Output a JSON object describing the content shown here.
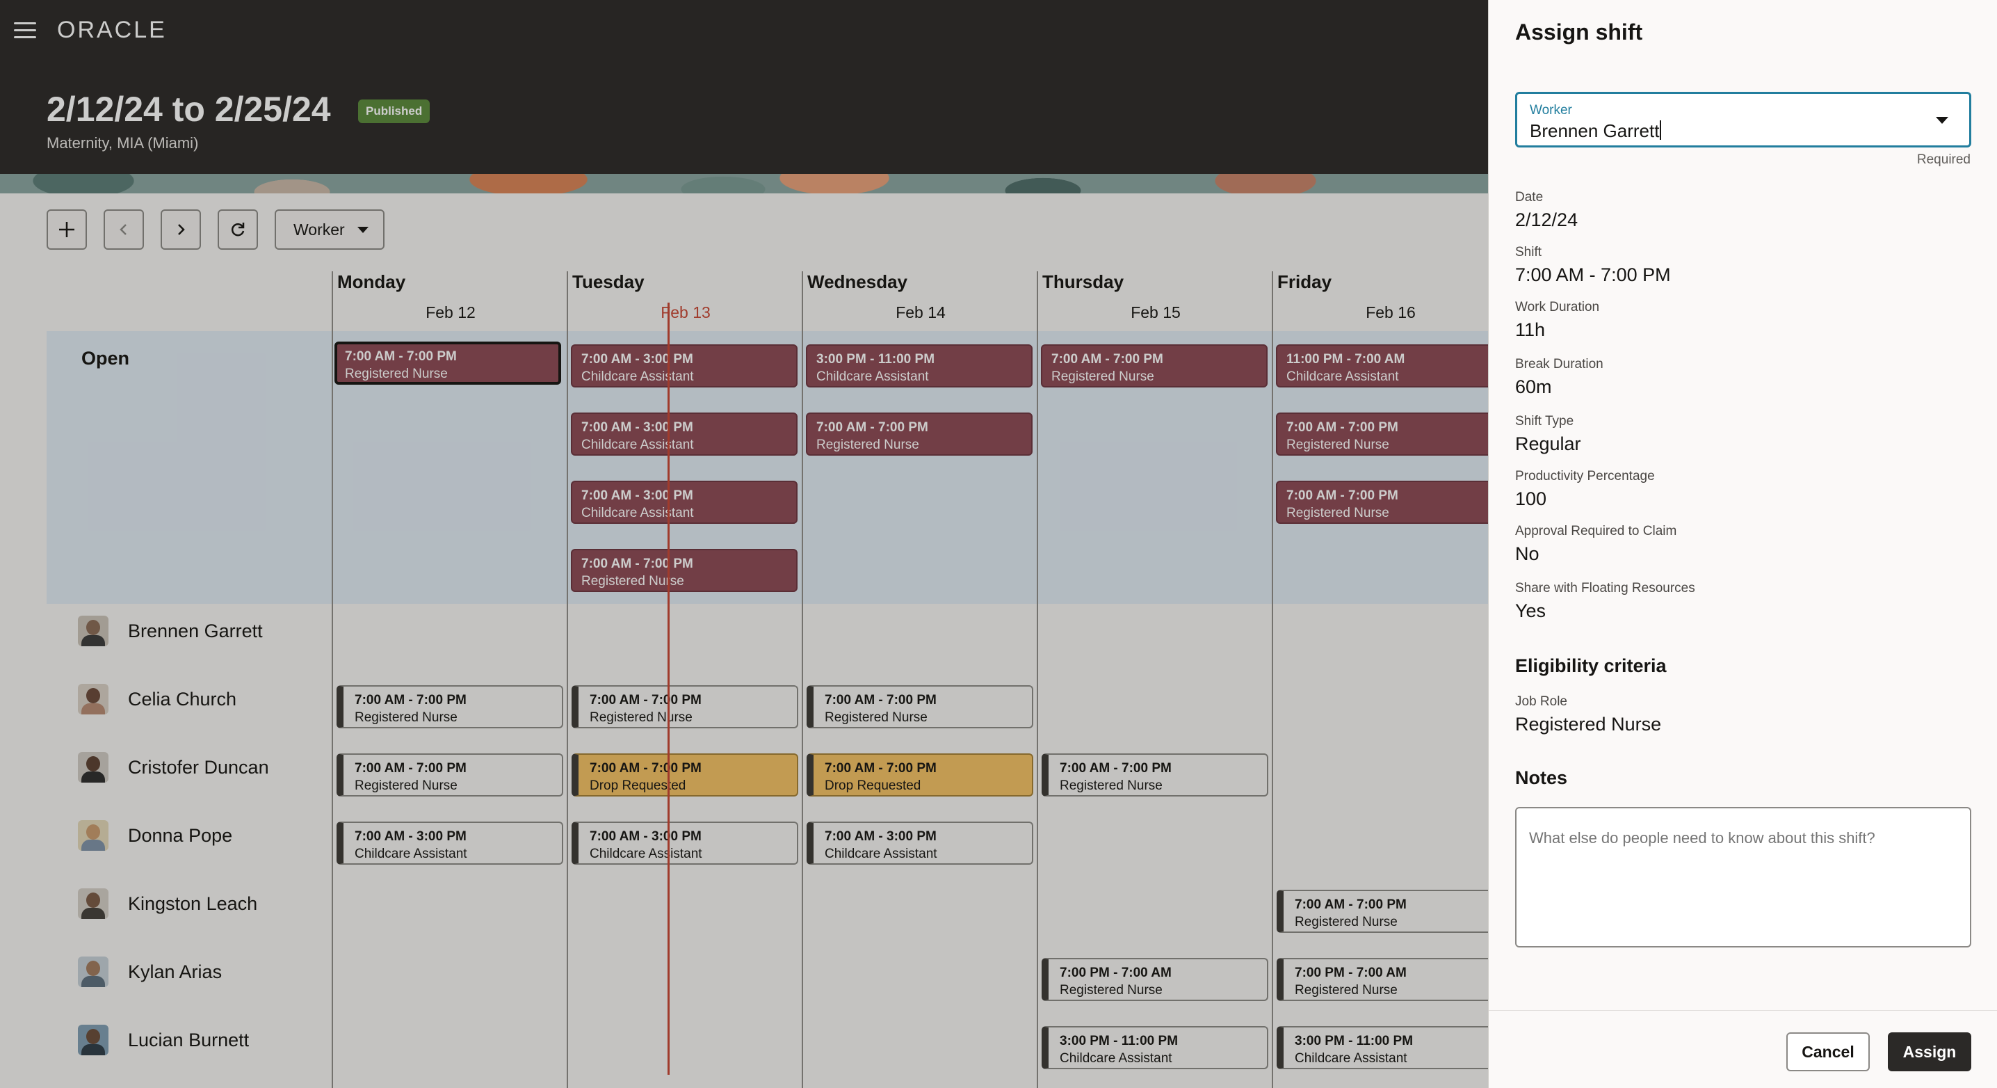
{
  "app": {
    "brand": "ORACLE",
    "schedule_range": "2/12/24 to 2/25/24",
    "status_badge": "Published",
    "location": "Maternity, MIA (Miami)"
  },
  "toolbar": {
    "view_label": "Worker"
  },
  "days": [
    {
      "name": "Monday",
      "date": "Feb 12"
    },
    {
      "name": "Tuesday",
      "date": "Feb 13"
    },
    {
      "name": "Wednesday",
      "date": "Feb 14"
    },
    {
      "name": "Thursday",
      "date": "Feb 15"
    },
    {
      "name": "Friday",
      "date": "Feb 16"
    }
  ],
  "open_label": "Open",
  "workers": [
    {
      "name": "Brennen Garrett"
    },
    {
      "name": "Celia Church"
    },
    {
      "name": "Cristofer Duncan"
    },
    {
      "name": "Donna Pope"
    },
    {
      "name": "Kingston Leach"
    },
    {
      "name": "Kylan Arias"
    },
    {
      "name": "Lucian Burnett"
    }
  ],
  "open_shifts": {
    "mon": [
      {
        "time": "7:00 AM - 7:00 PM",
        "role": "Registered Nurse"
      }
    ],
    "tue": [
      {
        "time": "7:00 AM - 3:00 PM",
        "role": "Childcare Assistant"
      },
      {
        "time": "7:00 AM - 3:00 PM",
        "role": "Childcare Assistant"
      },
      {
        "time": "7:00 AM - 3:00 PM",
        "role": "Childcare Assistant"
      },
      {
        "time": "7:00 AM - 7:00 PM",
        "role": "Registered Nurse"
      }
    ],
    "wed": [
      {
        "time": "3:00 PM - 11:00 PM",
        "role": "Childcare Assistant"
      },
      {
        "time": "7:00 AM - 7:00 PM",
        "role": "Registered Nurse"
      }
    ],
    "thu": [
      {
        "time": "7:00 AM - 7:00 PM",
        "role": "Registered Nurse"
      }
    ],
    "fri": [
      {
        "time": "11:00 PM - 7:00 AM",
        "role": "Childcare Assistant"
      },
      {
        "time": "7:00 AM - 7:00 PM",
        "role": "Registered Nurse"
      },
      {
        "time": "7:00 AM - 7:00 PM",
        "role": "Registered Nurse"
      }
    ]
  },
  "assigned_shifts": {
    "celia_mon": {
      "time": "7:00 AM - 7:00 PM",
      "role": "Registered Nurse"
    },
    "celia_tue": {
      "time": "7:00 AM - 7:00 PM",
      "role": "Registered Nurse"
    },
    "celia_wed": {
      "time": "7:00 AM - 7:00 PM",
      "role": "Registered Nurse"
    },
    "cristofer_mon": {
      "time": "7:00 AM - 7:00 PM",
      "role": "Registered Nurse"
    },
    "cristofer_tue": {
      "time": "7:00 AM - 7:00 PM",
      "role": "Drop Requested"
    },
    "cristofer_wed": {
      "time": "7:00 AM - 7:00 PM",
      "role": "Drop Requested"
    },
    "cristofer_thu": {
      "time": "7:00 AM - 7:00 PM",
      "role": "Registered Nurse"
    },
    "donna_mon": {
      "time": "7:00 AM - 3:00 PM",
      "role": "Childcare Assistant"
    },
    "donna_tue": {
      "time": "7:00 AM - 3:00 PM",
      "role": "Childcare Assistant"
    },
    "donna_wed": {
      "time": "7:00 AM - 3:00 PM",
      "role": "Childcare Assistant"
    },
    "kingston_fri": {
      "time": "7:00 AM - 7:00 PM",
      "role": "Registered Nurse"
    },
    "kylan_thu": {
      "time": "7:00 PM - 7:00 AM",
      "role": "Registered Nurse"
    },
    "kylan_fri": {
      "time": "7:00 PM - 7:00 AM",
      "role": "Registered Nurse"
    },
    "lucian_thu": {
      "time": "3:00 PM - 11:00 PM",
      "role": "Childcare Assistant"
    },
    "lucian_fri": {
      "time": "3:00 PM - 11:00 PM",
      "role": "Childcare Assistant"
    }
  },
  "drawer": {
    "title": "Assign shift",
    "worker_label": "Worker",
    "worker_value": "Brennen Garrett",
    "required_hint": "Required",
    "fields": [
      {
        "label": "Date",
        "value": "2/12/24"
      },
      {
        "label": "Shift",
        "value": "7:00 AM - 7:00 PM"
      },
      {
        "label": "Work Duration",
        "value": "11h"
      },
      {
        "label": "Break Duration",
        "value": "60m"
      },
      {
        "label": "Shift Type",
        "value": "Regular"
      },
      {
        "label": "Productivity Percentage",
        "value": "100"
      },
      {
        "label": "Approval Required to Claim",
        "value": "No"
      },
      {
        "label": "Share with Floating Resources",
        "value": "Yes"
      }
    ],
    "eligibility_heading": "Eligibility criteria",
    "job_role_label": "Job Role",
    "job_role_value": "Registered Nurse",
    "notes_heading": "Notes",
    "notes_placeholder": "What else do people need to know about this shift?",
    "cancel_label": "Cancel",
    "assign_label": "Assign"
  },
  "colors": {
    "open_shift": "#8c4a55",
    "drop_requested": "#f3c065",
    "focus_accent": "#227e9e",
    "current_time_line": "#c74634",
    "published_badge": "#5a8a3c"
  }
}
